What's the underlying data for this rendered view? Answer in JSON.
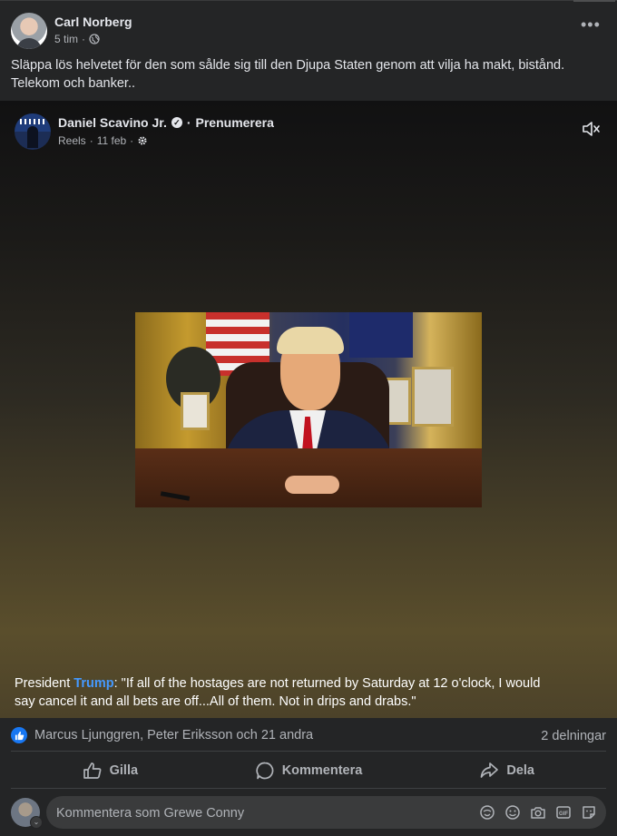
{
  "post": {
    "author": "Carl Norberg",
    "time": "5 tim",
    "separator": "·",
    "text": "Släppa lös helvetet för den som sålde sig till den Djupa Staten genom att vilja ha makt,  bistånd. Telekom och banker.."
  },
  "shared": {
    "author": "Daniel Scavino Jr.",
    "dot": "·",
    "subscribe": "Prenumerera",
    "source": "Reels",
    "date": "11 feb",
    "caption_pre": "President ",
    "caption_highlight": "Trump",
    "caption_post": ": \"If all of the hostages are not returned by Saturday at 12 o'clock, I would say cancel it and all bets are off...All of them. Not in drips and drabs.\""
  },
  "reactions": {
    "names": "Marcus Ljunggren, Peter Eriksson och 21 andra",
    "shares": "2 delningar"
  },
  "actions": {
    "like": "Gilla",
    "comment": "Kommentera",
    "share": "Dela"
  },
  "comment": {
    "placeholder": "Kommentera som Grewe Conny"
  },
  "colors": {
    "background": "#242526",
    "accent": "#1877f2",
    "highlight": "#4599ff",
    "muted_text": "#b0b3b8"
  },
  "icons": [
    "globe-icon",
    "more-icon",
    "verified-icon",
    "gear-icon",
    "mute-icon",
    "like-icon",
    "comment-icon",
    "share-icon",
    "avatar-sticker-icon",
    "emoji-icon",
    "camera-icon",
    "gif-icon",
    "sticker-icon"
  ]
}
